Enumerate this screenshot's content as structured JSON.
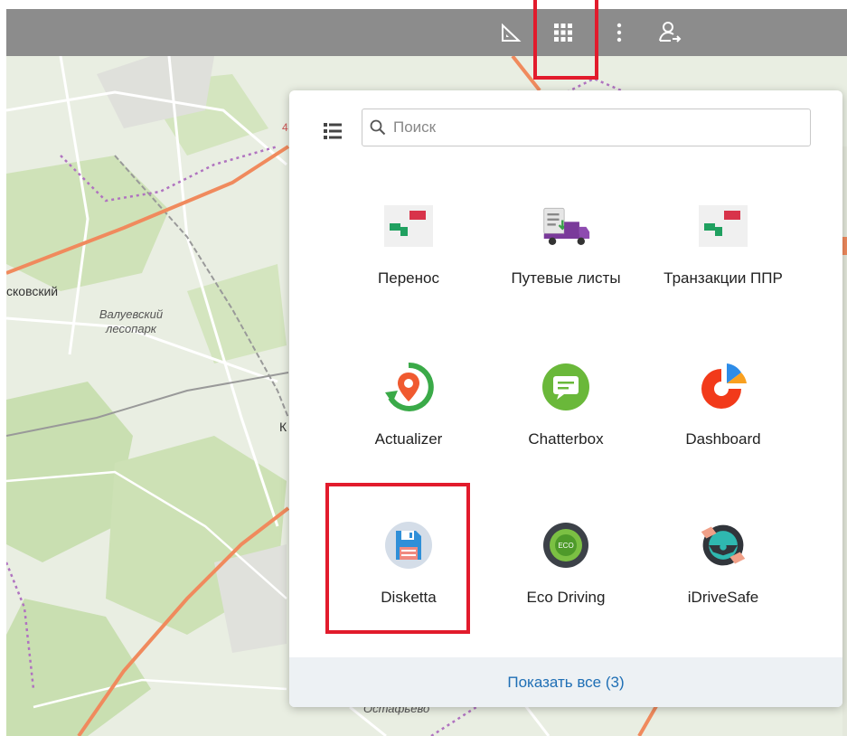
{
  "map": {
    "labels": {
      "district": "сковский",
      "park_line1": "Валуевский",
      "park_line2": "лесопарк",
      "village": "Остафьево",
      "road_number": "4",
      "letter": "К"
    },
    "colors": {
      "background": "#e9eee2",
      "forest": "#c9dfb1",
      "highway": "#f08a5d",
      "road": "#ffffff",
      "rail": "#999999",
      "boundary": "#b073c0"
    }
  },
  "toolbar": {
    "icons": [
      "ruler-icon",
      "apps-grid-icon",
      "more-vertical-icon",
      "user-logout-icon"
    ],
    "background": "#8c8c8c"
  },
  "apps_panel": {
    "search": {
      "placeholder": "Поиск",
      "value": ""
    },
    "apps": [
      {
        "name": "transfer",
        "label": "Перенос",
        "icon": "transfer-icon"
      },
      {
        "name": "waybills",
        "label": "Путевые листы",
        "icon": "delivery-truck-icon"
      },
      {
        "name": "fuel-transactions",
        "label": "Транзакции ППР",
        "icon": "transfer-icon"
      },
      {
        "name": "actualizer",
        "label": "Actualizer",
        "icon": "location-refresh-icon"
      },
      {
        "name": "chatterbox",
        "label": "Chatterbox",
        "icon": "chat-bubble-icon"
      },
      {
        "name": "dashboard",
        "label": "Dashboard",
        "icon": "pie-chart-icon"
      },
      {
        "name": "disketta",
        "label": "Disketta",
        "icon": "floppy-disk-icon"
      },
      {
        "name": "eco-driving",
        "label": "Eco Driving",
        "icon": "eco-steering-wheel-icon"
      },
      {
        "name": "idrivesafe",
        "label": "iDriveSafe",
        "icon": "steering-wheel-icon"
      }
    ],
    "footer_link": "Показать все (3)",
    "colors": {
      "highlight": "#e21b2c",
      "link": "#1f6fb5",
      "footer_bg": "#edf1f4"
    }
  }
}
